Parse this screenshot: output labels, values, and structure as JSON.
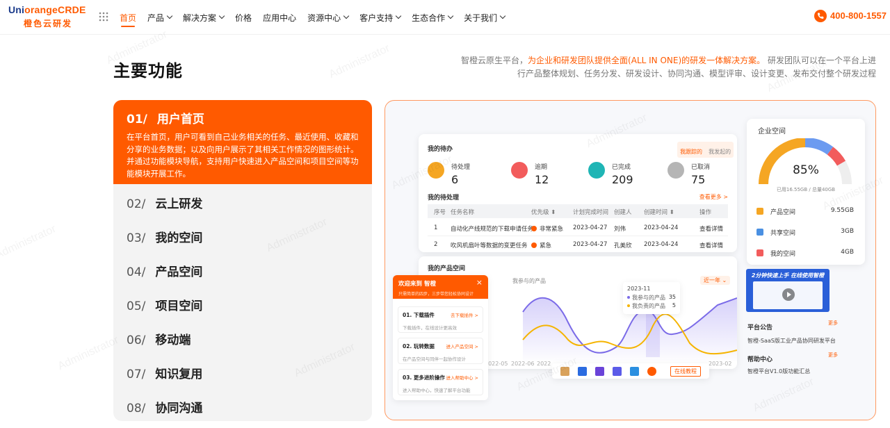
{
  "header": {
    "logo_prefix": "Uni",
    "logo_rest": "orangeCRDE",
    "logo_sub": "橙色云研发",
    "nav": [
      {
        "label": "首页",
        "dropdown": false,
        "active": true
      },
      {
        "label": "产品",
        "dropdown": true
      },
      {
        "label": "解决方案",
        "dropdown": true
      },
      {
        "label": "价格",
        "dropdown": false
      },
      {
        "label": "应用中心",
        "dropdown": false
      },
      {
        "label": "资源中心",
        "dropdown": true
      },
      {
        "label": "客户支持",
        "dropdown": true
      },
      {
        "label": "生态合作",
        "dropdown": true
      },
      {
        "label": "关于我们",
        "dropdown": true
      }
    ],
    "phone": "400-800-1557"
  },
  "section": {
    "title": "主要功能",
    "desc_pre": "智橙云原生平台，",
    "desc_highlight": "为企业和研发团队提供全面(ALL IN ONE)的研发一体解决方案。",
    "desc_post": "研发团队可以在一个平台上进行产品整体规划、任务分发、研发设计、协同沟通、模型评审、设计变更、发布交付整个研发过程"
  },
  "menu": {
    "active": {
      "num": "01/",
      "title": "用户首页",
      "desc": "在平台首页，用户可看到自己业务相关的任务、最近使用、收藏和分享的业务数据；以及向用户展示了其相关工作情况的图形统计。并通过功能模块导航，支持用户快速进入产品空间和项目空间等功能模块开展工作。"
    },
    "items": [
      {
        "num": "02/",
        "title": "云上研发"
      },
      {
        "num": "03/",
        "title": "我的空间"
      },
      {
        "num": "04/",
        "title": "产品空间"
      },
      {
        "num": "05/",
        "title": "项目空间"
      },
      {
        "num": "06/",
        "title": "移动端"
      },
      {
        "num": "07/",
        "title": "知识复用"
      },
      {
        "num": "08/",
        "title": "协同沟通"
      }
    ]
  },
  "dashboard": {
    "todo": {
      "title": "我的待办",
      "tab_active": "我跟踪的",
      "tab_other": "我发起的",
      "stats": [
        {
          "label": "待处理",
          "value": "6",
          "color": "#f5a623"
        },
        {
          "label": "逾期",
          "value": "12",
          "color": "#f25c5c"
        },
        {
          "label": "已完成",
          "value": "209",
          "color": "#1fb5b5"
        },
        {
          "label": "已取消",
          "value": "75",
          "color": "#b5b5b5"
        }
      ],
      "pending_title": "我的待处理",
      "more": "查看更多 >",
      "headers": [
        "序号",
        "任务名称",
        "优先级 ⬍",
        "计划完成时间",
        "创建人",
        "创建时间 ⬍",
        "操作"
      ],
      "rows": [
        [
          "1",
          "自动化产线规范的下载申请任务",
          "非常紧急",
          "2023-04-27",
          "刘伟",
          "2023-04-24",
          "查看详情"
        ],
        [
          "2",
          "吹风机扇叶等数据的变更任务",
          "紧急",
          "2023-04-27",
          "孔美欣",
          "2023-04-24",
          "查看详情"
        ]
      ]
    },
    "products": {
      "title": "我的产品空间",
      "subtitle": "我参与的产品",
      "range": "近一年",
      "x_labels": [
        "2022-05",
        "2022-06",
        "2022",
        "2023-02"
      ],
      "tooltip": {
        "date": "2023-11",
        "rows": [
          {
            "label": "我参与的产品",
            "value": "35"
          },
          {
            "label": "我负责的产品",
            "value": "5"
          }
        ]
      },
      "online_tutorial": "在线教程"
    },
    "enterprise": {
      "title": "企业空间",
      "percent": "85%",
      "usage": "已用16.55GB / 总量40GB",
      "rows": [
        {
          "label": "产品空间",
          "value": "9.55GB",
          "color": "#f5a623"
        },
        {
          "label": "共享空间",
          "value": "3GB",
          "color": "#4a90e2"
        },
        {
          "label": "我的空间",
          "value": "4GB",
          "color": "#f25c5c"
        }
      ]
    },
    "video": {
      "caption": "2分钟快速上手 在线使用智橙"
    },
    "notice": {
      "title": "平台公告",
      "more": "更多",
      "text": "智橙-SaaS版工业产品协同研发平台"
    },
    "help": {
      "title": "帮助中心",
      "more": "更多",
      "text": "智橙平台V1.0版功能汇总"
    },
    "welcome": {
      "title": "欢迎来到 智橙",
      "subtitle": "只需简单的四步，三步带您轻松协同设计",
      "steps": [
        {
          "title": "01. 下载插件",
          "link": "去下载插件 >",
          "desc": "下载插件，在线设计更高效"
        },
        {
          "title": "02. 玩转数据",
          "link": "进入产品空间 >",
          "desc": "在产品空间与同伴一起协作设计"
        },
        {
          "title": "03. 更多进阶操作",
          "link": "进入帮助中心 >",
          "desc": "进入帮助中心，快速了解平台功能"
        }
      ]
    }
  },
  "watermark": "Administrator"
}
